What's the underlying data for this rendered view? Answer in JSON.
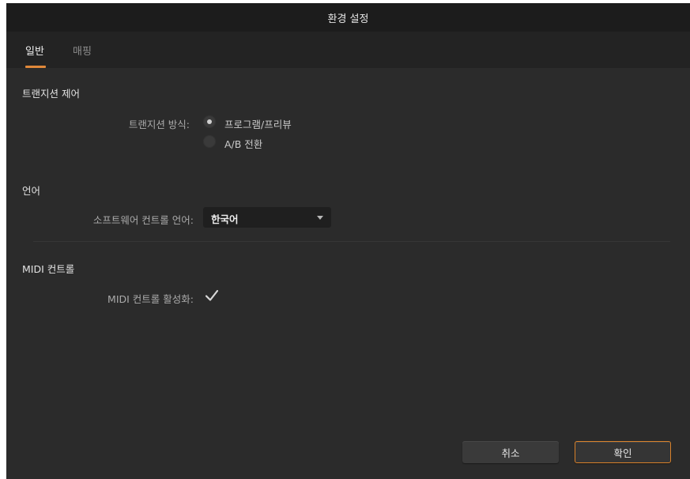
{
  "window": {
    "title": "환경 설정"
  },
  "tabs": [
    {
      "label": "일반",
      "active": true
    },
    {
      "label": "매핑",
      "active": false
    }
  ],
  "transition": {
    "section_title": "트랜지션 제어",
    "label": "트랜지션 방식:",
    "options": [
      {
        "label": "프로그램/프리뷰",
        "selected": true
      },
      {
        "label": "A/B 전환",
        "selected": false
      }
    ]
  },
  "language": {
    "section_title": "언어",
    "label": "소프트웨어 컨트롤 언어:",
    "selected": "한국어"
  },
  "midi": {
    "section_title": "MIDI 컨트롤",
    "label": "MIDI 컨트롤 활성화:",
    "enabled": true
  },
  "buttons": {
    "cancel": "취소",
    "ok": "확인"
  },
  "colors": {
    "accent": "#e0883a",
    "background": "#2b2b2b",
    "titlebar": "#1c1c1c"
  }
}
